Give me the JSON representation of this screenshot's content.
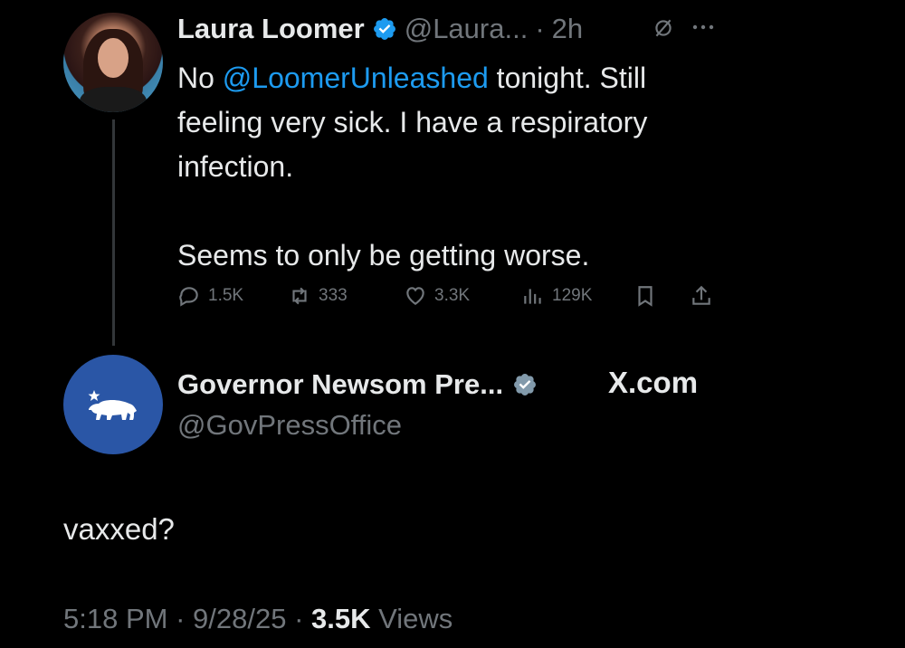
{
  "tweet": {
    "author_name": "Laura Loomer",
    "author_handle": "@Laura...",
    "separator": "·",
    "time": "2h",
    "text_prefix": "No ",
    "mention": "@LoomerUnleashed",
    "text_line1_rest": " tonight. Still",
    "text_rest": "feeling very sick. I have a respiratory\ninfection.\n\nSeems to only be getting worse.",
    "replies": "1.5K",
    "reposts": "333",
    "likes": "3.3K",
    "views": "129K"
  },
  "reply": {
    "author_name": "Governor Newsom Pre...",
    "author_handle": "@GovPressOffice",
    "source_label": "X.com",
    "text": "vaxxed?",
    "time": "5:18 PM",
    "date": "9/28/25",
    "views_count": "3.5K",
    "views_label": "Views"
  },
  "colors": {
    "background": "#000000",
    "text": "#e7e9ea",
    "secondary": "#71767b",
    "link": "#1d9bf0",
    "gov_avatar": "#2a56a6",
    "gov_badge": "#829aab"
  },
  "icons": [
    "verified-badge-icon",
    "mute-icon",
    "more-icon",
    "reply-icon",
    "repost-icon",
    "like-icon",
    "views-icon",
    "bookmark-icon",
    "share-icon",
    "bear-flag-icon"
  ]
}
